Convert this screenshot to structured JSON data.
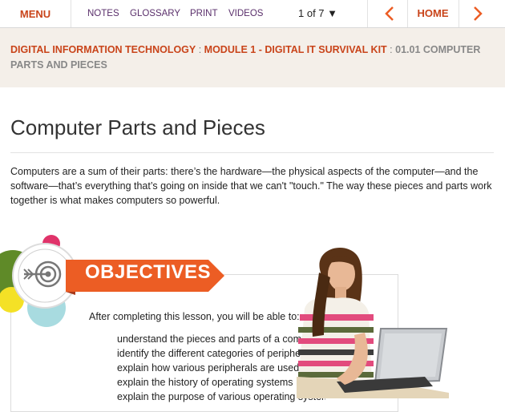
{
  "nav": {
    "menu_label": "MENU",
    "links": [
      "NOTES",
      "GLOSSARY",
      "PRINT",
      "VIDEOS"
    ],
    "pager": "1 of 7 ▼",
    "home_label": "HOME"
  },
  "breadcrumb": {
    "course": "DIGITAL INFORMATION TECHNOLOGY",
    "module": "MODULE 1 - DIGITAL IT SURVIVAL KIT",
    "lesson": "01.01 COMPUTER PARTS AND PIECES",
    "separator": " : "
  },
  "page": {
    "title": "Computer Parts and Pieces",
    "intro": "Computers are a sum of their parts: there’s the hardware—the physical aspects of the computer—and the software—that’s everything that’s going on inside that we can't \"touch.\" The way these pieces and parts work together is what makes computers so powerful."
  },
  "objectives": {
    "banner": "OBJECTIVES",
    "lead": "After completing this lesson, you will be able to:",
    "items": [
      "understand the pieces and parts of a computer",
      "identify the different categories of peripherals",
      "explain how various peripherals are used",
      "explain the history of operating systems",
      "explain the purpose of various operating systems"
    ]
  },
  "colors": {
    "accent": "#c9441a",
    "nav_link": "#5a2f6b",
    "banner": "#ec5d24",
    "breadcrumb_band": "#f4efe9"
  },
  "icons": {
    "target": "target-arrow-icon",
    "prev": "chevron-left-icon",
    "next": "chevron-right-icon"
  }
}
